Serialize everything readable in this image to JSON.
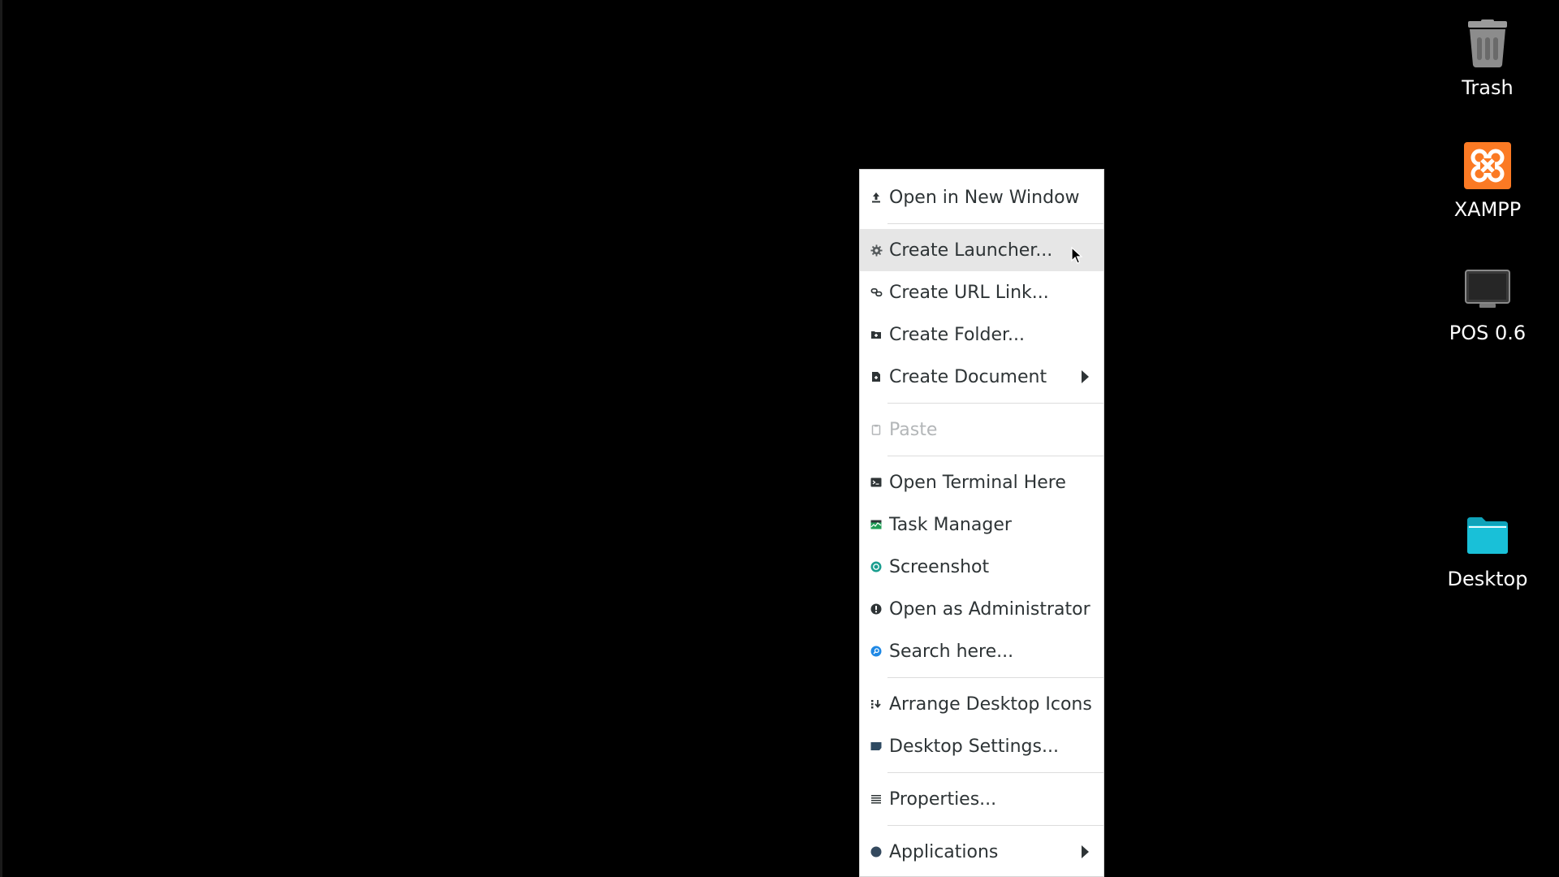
{
  "desktop": {
    "background_color": "#000000",
    "icons": [
      {
        "label": "Trash",
        "icon": "trash-icon"
      },
      {
        "label": "XAMPP",
        "icon": "xampp-icon",
        "color": "#fb7a24"
      },
      {
        "label": "POS 0.6",
        "icon": "monitor-icon"
      },
      {
        "label": "Desktop",
        "icon": "folder-icon",
        "color": "#19c0d8"
      }
    ]
  },
  "context_menu": {
    "items": [
      {
        "label": "Open in New Window",
        "icon": "upload-icon"
      },
      {
        "label": "Create Launcher...",
        "icon": "gear-icon",
        "hovered": true
      },
      {
        "label": "Create URL Link...",
        "icon": "link-icon"
      },
      {
        "label": "Create Folder...",
        "icon": "new-folder-icon"
      },
      {
        "label": "Create Document",
        "icon": "new-document-icon",
        "submenu": true
      },
      {
        "label": "Paste",
        "icon": "clipboard-icon",
        "disabled": true
      },
      {
        "label": "Open Terminal Here",
        "icon": "terminal-icon"
      },
      {
        "label": "Task Manager",
        "icon": "task-manager-icon"
      },
      {
        "label": "Screenshot",
        "icon": "screenshot-icon"
      },
      {
        "label": "Open as Administrator",
        "icon": "admin-icon"
      },
      {
        "label": "Search here...",
        "icon": "search-icon"
      },
      {
        "label": "Arrange Desktop Icons",
        "icon": "arrange-icon"
      },
      {
        "label": "Desktop Settings...",
        "icon": "desktop-settings-icon"
      },
      {
        "label": "Properties...",
        "icon": "properties-icon"
      },
      {
        "label": "Applications",
        "icon": "applications-icon",
        "submenu": true
      }
    ],
    "colors": {
      "hover_bg": "#e6e6e6",
      "text": "#2e3436",
      "disabled_text": "#b3b6b8"
    }
  }
}
